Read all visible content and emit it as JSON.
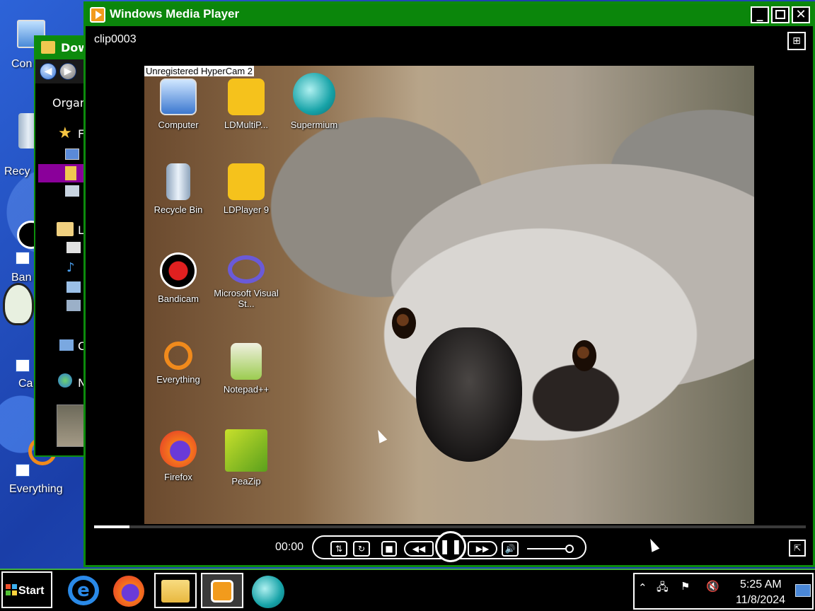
{
  "desktop": {
    "labels": {
      "computer": "Con",
      "recycle": "Recy",
      "bandicam": "Ban",
      "ca": "Ca",
      "everything": "Everything"
    }
  },
  "explorer": {
    "title": "Dow",
    "organize": "Organ",
    "tree": [
      "F",
      "L",
      "C",
      "N"
    ]
  },
  "player": {
    "title": "Windows Media Player",
    "clip_name": "clip0003",
    "watermark": "Unregistered HyperCam 2",
    "time": "00:00",
    "progress_fraction": 0.05,
    "volume_fraction": 1.0,
    "accent": "#0b860b",
    "video_icons": [
      {
        "label": "Computer",
        "icon": "computer-icon"
      },
      {
        "label": "LDMultiP...",
        "icon": "ldmultiplayer-icon"
      },
      {
        "label": "Supermium",
        "icon": "supermium-icon"
      },
      {
        "label": "Recycle Bin",
        "icon": "recycle-bin-icon"
      },
      {
        "label": "LDPlayer 9",
        "icon": "ldplayer-icon"
      },
      {
        "label": "Bandicam",
        "icon": "bandicam-icon"
      },
      {
        "label": "Microsoft Visual St...",
        "icon": "visual-studio-icon"
      },
      {
        "label": "Everything",
        "icon": "everything-icon"
      },
      {
        "label": "Notepad++",
        "icon": "notepadpp-icon"
      },
      {
        "label": "Firefox",
        "icon": "firefox-icon"
      },
      {
        "label": "PeaZip",
        "icon": "peazip-icon"
      }
    ]
  },
  "taskbar": {
    "start_label": "Start",
    "apps": [
      "internet-explorer-icon",
      "firefox-icon",
      "file-explorer-icon",
      "media-player-icon",
      "supermium-icon"
    ],
    "clock_time": "5:25 AM",
    "clock_date": "11/8/2024"
  }
}
